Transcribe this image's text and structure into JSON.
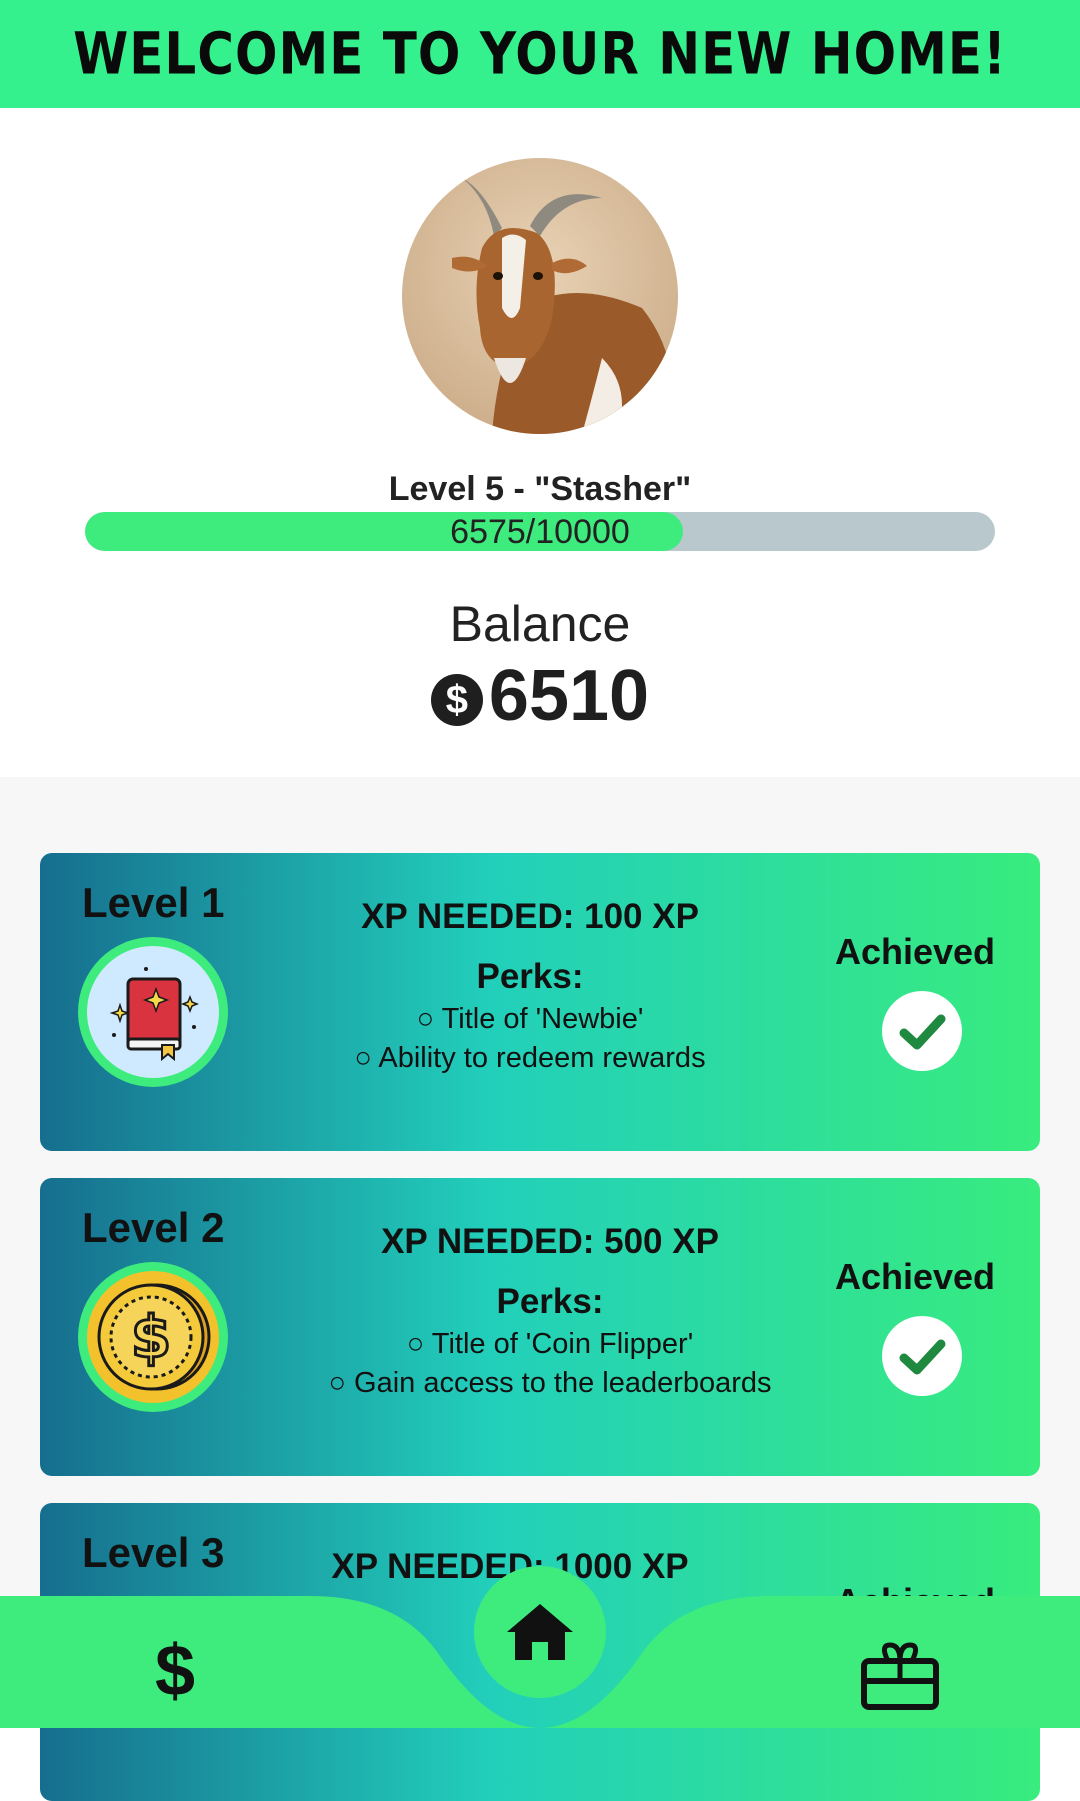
{
  "header": {
    "title": "WELCOME TO YOUR NEW HOME!"
  },
  "profile": {
    "avatar_icon": "goat-photo",
    "level_title": "Level 5 - \"Stasher\"",
    "xp_text": "6575/10000",
    "xp_current": 6575,
    "xp_max": 10000
  },
  "balance": {
    "label": "Balance",
    "currency_icon": "dollar-coin-icon",
    "value": "6510"
  },
  "levels": [
    {
      "level": "Level 1",
      "badge_icon": "sparkle-book-icon",
      "xp_needed": "XP NEEDED: 100 XP",
      "perks_label": "Perks:",
      "perks": [
        "○ Title of 'Newbie'",
        "○ Ability to redeem rewards"
      ],
      "status": "Achieved"
    },
    {
      "level": "Level 2",
      "badge_icon": "gold-coin-icon",
      "xp_needed": "XP NEEDED: 500 XP",
      "perks_label": "Perks:",
      "perks": [
        "○ Title of 'Coin Flipper'",
        "○ Gain access to the leaderboards"
      ],
      "status": "Achieved"
    },
    {
      "level": "Level 3",
      "xp_needed": "XP NEEDED: 1000 XP",
      "status": "Achieved"
    }
  ],
  "bottom_nav": {
    "left_icon": "dollar-icon",
    "left_glyph": "$",
    "center_icon": "home-icon",
    "right_icon": "gift-card-icon"
  },
  "colors": {
    "accent": "#3eec7e",
    "header_bg": "#34f08d",
    "card_gradient_start": "#166e8e",
    "card_gradient_end": "#38ec7e",
    "xp_track": "#b8c8cd"
  }
}
